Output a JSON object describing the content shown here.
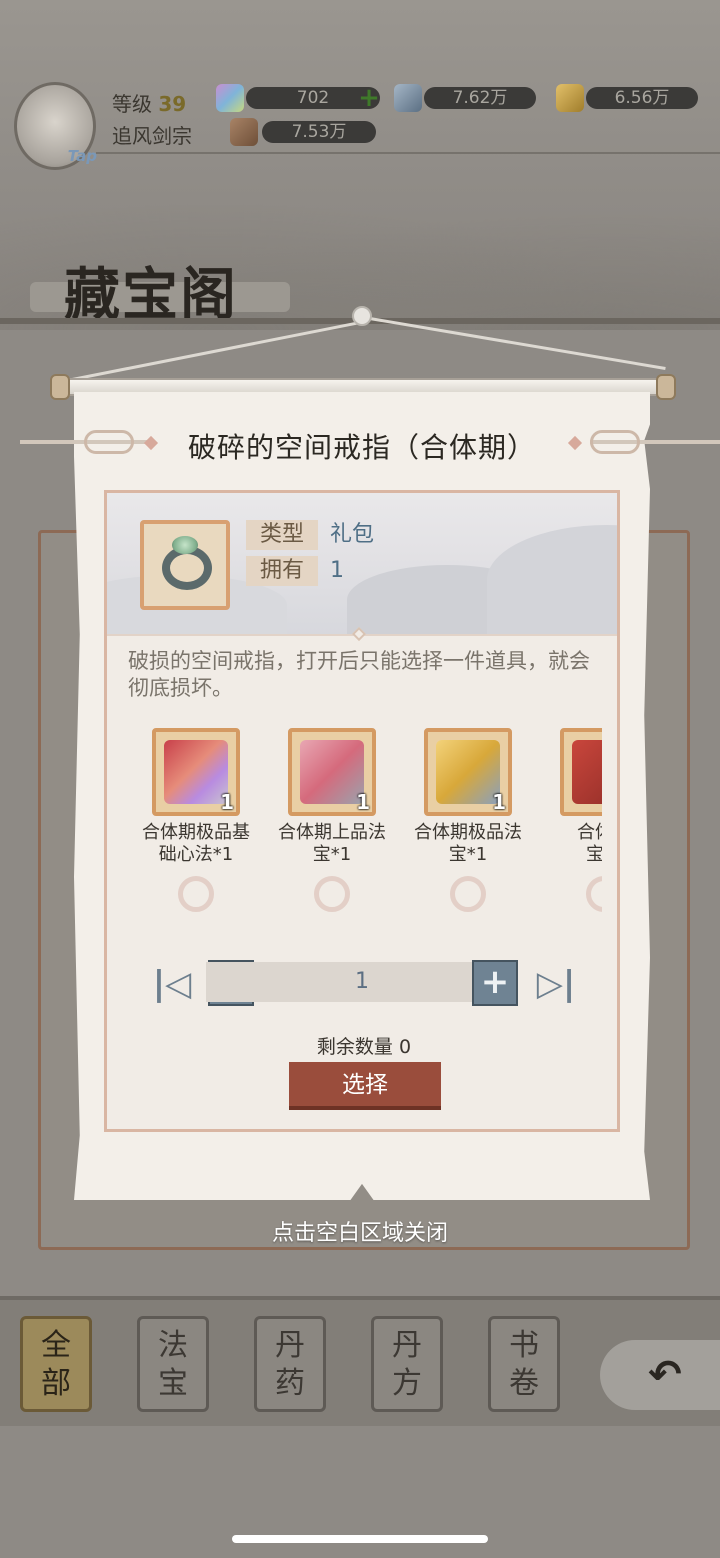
{
  "hud": {
    "level_label": "等级",
    "level": "39",
    "sect_name": "追风剑宗",
    "avatar_badge": "Tap",
    "resources": [
      {
        "icon": "rainbow-crystal-icon",
        "value": "702"
      },
      {
        "icon": "blue-stone-icon",
        "value": "7.62万"
      },
      {
        "icon": "gold-ingot-icon",
        "value": "6.56万"
      },
      {
        "icon": "ore-icon",
        "value": "7.53万"
      }
    ],
    "add_label": "+"
  },
  "page_title": "藏宝阁",
  "modal": {
    "title": "破碎的空间戒指（合体期）",
    "item_icon": "jade-ring-icon",
    "type_label": "类型",
    "type_value": "礼包",
    "own_label": "拥有",
    "own_value": "1",
    "description": "破损的空间戒指，打开后只能选择一件道具，就会彻底损坏。",
    "rewards": [
      {
        "name_line1": "合体期极品基",
        "name_line2": "础心法*1",
        "count": "1",
        "icon": "treasure-box-icon"
      },
      {
        "name_line1": "合体期上品法",
        "name_line2": "宝*1",
        "count": "1",
        "icon": "sword-bundle-icon"
      },
      {
        "name_line1": "合体期极品法",
        "name_line2": "宝*1",
        "count": "1",
        "icon": "golden-sword-bundle-icon"
      },
      {
        "name_line1": "合体期",
        "name_line2": "宝杉",
        "count": "",
        "icon": "red-pouch-icon"
      }
    ],
    "quantity": "1",
    "minus_label": "−",
    "plus_label": "+",
    "first_label": "|◁",
    "last_label": "▷|",
    "remaining": "剩余数量 0",
    "select_label": "选择"
  },
  "close_hint": "点击空白区域关闭",
  "nav_tabs": [
    {
      "top": "全",
      "bottom": "部",
      "active": true
    },
    {
      "top": "法",
      "bottom": "宝",
      "active": false
    },
    {
      "top": "丹",
      "bottom": "药",
      "active": false
    },
    {
      "top": "丹",
      "bottom": "方",
      "active": false
    },
    {
      "top": "书",
      "bottom": "卷",
      "active": false
    }
  ],
  "back_icon": "back-arrow-icon",
  "colors": {
    "accent_button": "#9a4d3c",
    "frame_orange": "#d49a62",
    "qty_blue": "#6f8393"
  }
}
